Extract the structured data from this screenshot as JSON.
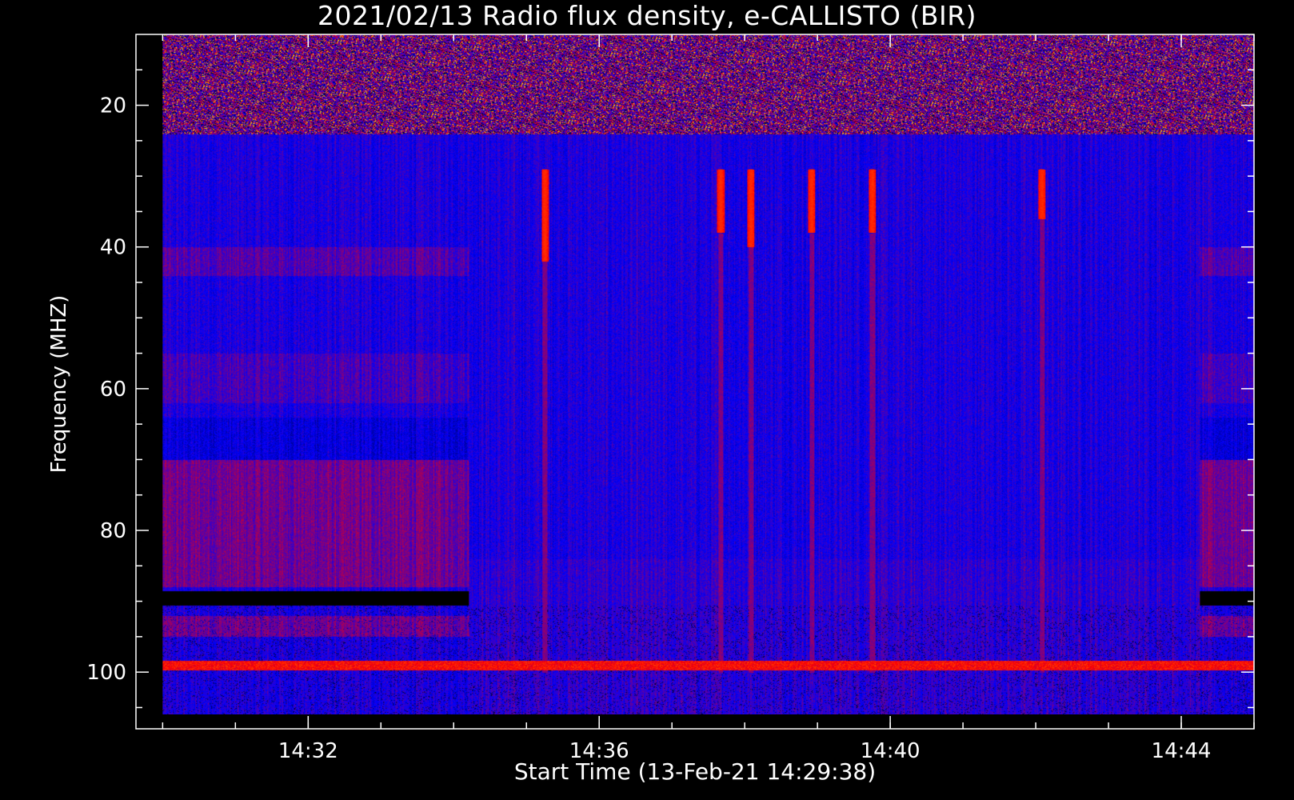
{
  "chart_data": {
    "type": "heatmap",
    "title": "2021/02/13  Radio flux density, e-CALLISTO (BIR)",
    "xlabel": "Start Time (13-Feb-21 14:29:38)",
    "ylabel": "Frequency (MHZ)",
    "x_axis": {
      "unit": "time",
      "range": [
        "14:29:38",
        "14:45:00"
      ],
      "ticks": [
        "14:32",
        "14:36",
        "14:40",
        "14:44"
      ],
      "minor_step_minutes": 1
    },
    "y_axis": {
      "unit": "MHz",
      "range": [
        10,
        108
      ],
      "inverted": true,
      "ticks": [
        20,
        40,
        60,
        80,
        100
      ],
      "minor_step": 5
    },
    "data_extent": {
      "time_start": "14:30:00",
      "time_end": "14:45:00",
      "freq_min": 10,
      "freq_max": 106
    },
    "colormap": [
      "#000000",
      "#0000ff",
      "#ff0000",
      "#ffff00"
    ],
    "features": {
      "rfi_band_mhz": [
        10,
        24
      ],
      "data_gap_mhz": [
        88.5,
        90.5
      ],
      "gap_present_intervals": [
        [
          "14:30:00",
          "14:34:12"
        ],
        [
          "14:44:15",
          "14:45:00"
        ]
      ],
      "bright_lines_mhz": [
        99
      ],
      "bursts": [
        {
          "time": "14:35:15",
          "freq_range_mhz": [
            29,
            42
          ]
        },
        {
          "time": "14:37:40",
          "freq_range_mhz": [
            29,
            38
          ]
        },
        {
          "time": "14:38:05",
          "freq_range_mhz": [
            29,
            40
          ]
        },
        {
          "time": "14:38:55",
          "freq_range_mhz": [
            29,
            38
          ]
        },
        {
          "time": "14:39:45",
          "freq_range_mhz": [
            29,
            38
          ]
        },
        {
          "time": "14:42:05",
          "freq_range_mhz": [
            29,
            36
          ]
        }
      ]
    }
  }
}
